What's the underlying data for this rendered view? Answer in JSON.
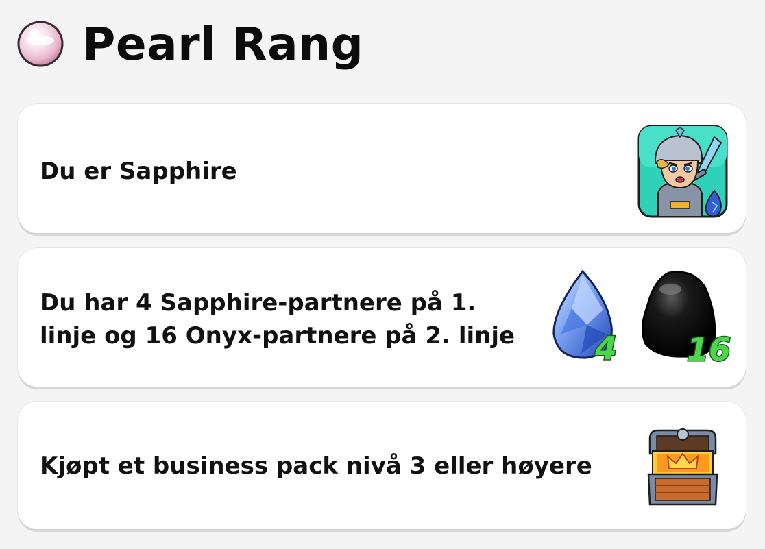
{
  "header": {
    "title": "Pearl Rang",
    "icon": "pearl-icon"
  },
  "requirements": [
    {
      "text": "Du er Sapphire",
      "icon": "sapphire-knight-avatar-icon"
    },
    {
      "text_line1": "Du har 4 Sapphire-partnere på 1.",
      "text_line2": "linje og 16 Onyx-partnere på 2. linje",
      "badges": [
        {
          "icon": "sapphire-gem-icon",
          "count": "4"
        },
        {
          "icon": "onyx-stone-icon",
          "count": "16"
        }
      ]
    },
    {
      "text": "Kjøpt et business pack nivå 3 eller høyere",
      "icon": "treasure-chest-icon"
    }
  ],
  "colors": {
    "background": "#f4f4f4",
    "card": "#ffffff",
    "count_green": "#4cd64c",
    "sapphire": "#2f5fd6",
    "avatar_bg": "#2fd1b8"
  }
}
